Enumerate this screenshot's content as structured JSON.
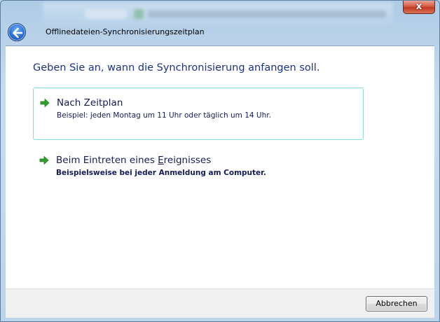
{
  "window": {
    "title": "Offlinedateien-Synchronisierungszeitplan",
    "close_label": "x"
  },
  "main": {
    "heading": "Geben Sie an, wann die Synchronisierung anfangen soll.",
    "options": [
      {
        "title": "Nach Zeitplan",
        "description": "Beispiel: jeden Montag um 11 Uhr oder täglich um 14 Uhr."
      },
      {
        "title_prefix": "Beim Eintreten eines ",
        "title_accel": "E",
        "title_suffix": "reignisses",
        "description": "Beispielsweise bei jeder Anmeldung am Computer."
      }
    ]
  },
  "footer": {
    "cancel_label": "Abbrechen"
  },
  "colors": {
    "heading": "#1e3287",
    "option_text": "#151c55",
    "arrow": "#2fa12f",
    "hover_border": "#8ddcd9"
  },
  "icons": {
    "back": "back-arrow-icon",
    "option_arrow": "green-arrow-icon"
  }
}
